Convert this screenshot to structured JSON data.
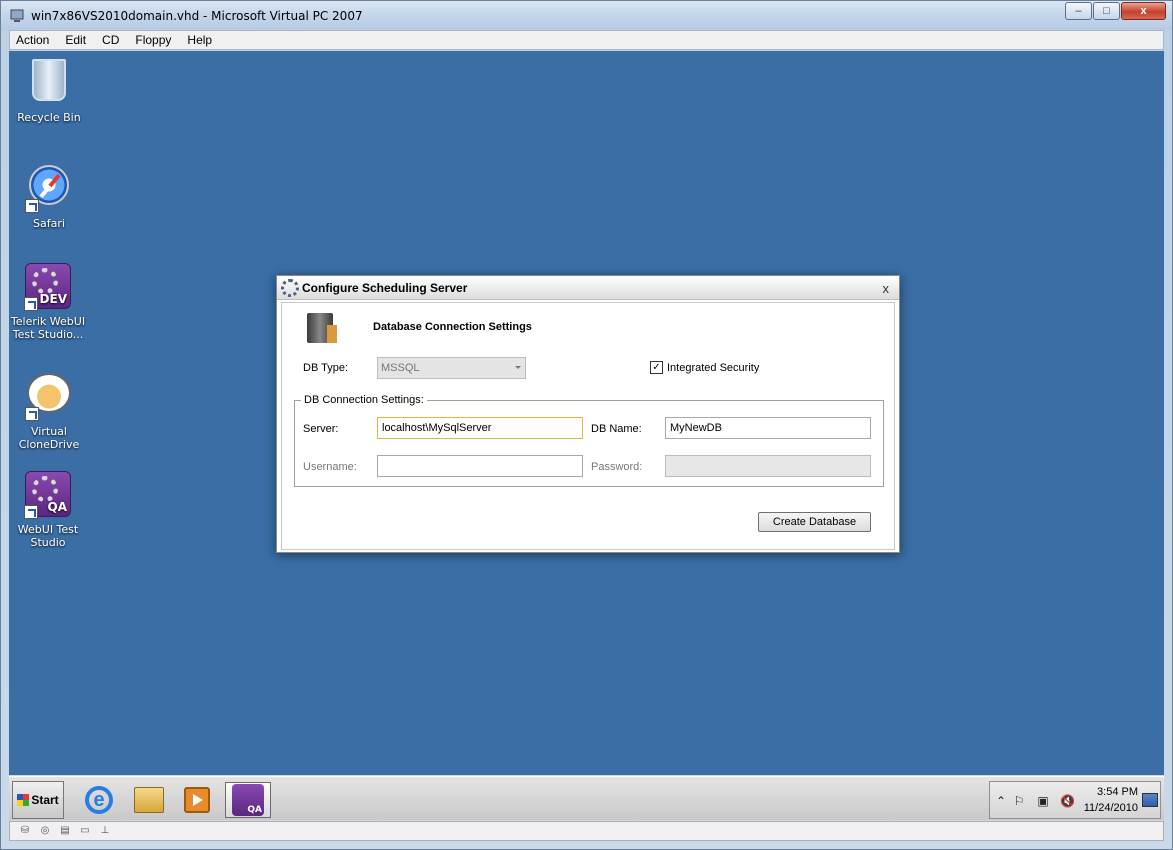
{
  "host": {
    "title": "win7x86VS2010domain.vhd - Microsoft Virtual PC 2007",
    "menu": [
      "Action",
      "Edit",
      "CD",
      "Floppy",
      "Help"
    ],
    "buttons": {
      "minimize": "–",
      "maximize": "□",
      "close": "x"
    }
  },
  "desktop": {
    "icons": [
      {
        "label": "Recycle Bin",
        "icon": "recycle-bin-icon"
      },
      {
        "label": "Safari",
        "icon": "safari-icon"
      },
      {
        "label": "Telerik WebUI Test Studio...",
        "icon": "webui-dev-icon",
        "tag": "DEV"
      },
      {
        "label": "Virtual CloneDrive",
        "icon": "clonedrive-icon"
      },
      {
        "label": "WebUI Test Studio",
        "icon": "webui-qa-icon",
        "tag": "QA"
      }
    ],
    "background": "#3a6ea5"
  },
  "dialog": {
    "title": "Configure Scheduling Server",
    "close": "x",
    "heading": "Database Connection Settings",
    "db_type_label": "DB Type:",
    "db_type_value": "MSSQL",
    "integrated_security_label": "Integrated Security",
    "integrated_security_checked": true,
    "check_mark": "✓",
    "group_title": "DB Connection Settings:",
    "server_label": "Server:",
    "server_value": "localhost\\MySqlServer",
    "db_name_label": "DB Name:",
    "db_name_value": "MyNewDB",
    "username_label": "Username:",
    "username_value": "",
    "password_label": "Password:",
    "password_value": "",
    "create_button": "Create Database"
  },
  "taskbar": {
    "start_label": "Start",
    "apps": [
      "internet-explorer-icon",
      "windows-explorer-icon",
      "media-player-icon",
      "webui-qa-icon"
    ],
    "active_app_tag": "QA",
    "ie_glyph": "e",
    "time": "3:54 PM",
    "date": "11/24/2010",
    "tray_glyphs": {
      "chevron": "⌃",
      "flag": "⚐",
      "network": "▣",
      "volume": "🔇"
    }
  },
  "statusbar": {
    "glyphs": [
      "⛁",
      "◎",
      "▤",
      "▭",
      "⊥"
    ]
  }
}
